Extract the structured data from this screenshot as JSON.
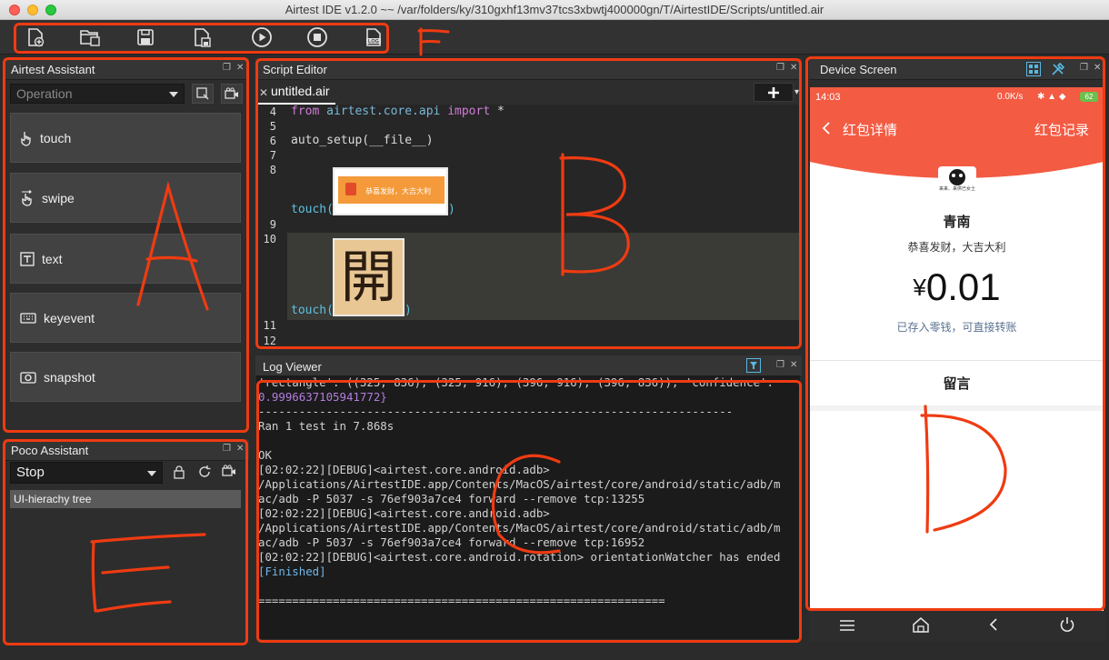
{
  "window": {
    "title": "Airtest IDE v1.2.0 ~~ /var/folders/ky/310gxhf13mv37tcs3xbwtj400000gn/T/AirtestIDE/Scripts/untitled.air"
  },
  "toolbar": {
    "buttons": [
      "new-script-icon",
      "open-folder-icon",
      "save-icon",
      "save-as-icon",
      "run-icon",
      "stop-icon",
      "log-icon"
    ],
    "log_label": "LOG"
  },
  "annotations": [
    "A",
    "B",
    "C",
    "D",
    "E",
    "F"
  ],
  "airtest_assistant": {
    "title": "Airtest Assistant",
    "select_placeholder": "Operation",
    "actions": [
      {
        "label": "touch",
        "icon": "touch-hand-icon"
      },
      {
        "label": "swipe",
        "icon": "swipe-hand-icon"
      },
      {
        "label": "text",
        "icon": "text-icon"
      },
      {
        "label": "keyevent",
        "icon": "keyboard-icon"
      },
      {
        "label": "snapshot",
        "icon": "camera-icon"
      }
    ]
  },
  "poco_assistant": {
    "title": "Poco Assistant",
    "mode": "Stop",
    "tree_item": "UI-hierachy tree"
  },
  "script_editor": {
    "title": "Script Editor",
    "tab": "untitled.air",
    "lines": [
      {
        "n": "4",
        "code": [
          "from",
          " airtest.core.api ",
          "import",
          " *"
        ]
      },
      {
        "n": "5",
        "code": []
      },
      {
        "n": "6",
        "code": [
          "auto_setup(__file__)"
        ]
      },
      {
        "n": "7",
        "code": []
      },
      {
        "n": "8",
        "code": []
      },
      {
        "n": "9",
        "code": []
      },
      {
        "n": "10",
        "code": []
      },
      {
        "n": "11",
        "code": []
      },
      {
        "n": "12",
        "code": []
      }
    ],
    "touch_call_1": "touch(",
    "touch_call_2": "touch(",
    "close_paren": ")",
    "thumb1_text": "恭喜发财，大吉大利",
    "thumb2_char": "開"
  },
  "log_viewer": {
    "title": "Log Viewer",
    "lines": [
      "'rectangle': ((325, 836), (325, 916), (396, 916), (396, 836)), 'confidence':",
      "0.9996637105941772}",
      "----------------------------------------------------------------------",
      "Ran 1 test in 7.868s",
      "",
      "OK",
      "[02:02:22][DEBUG]<airtest.core.android.adb>",
      "/Applications/AirtestIDE.app/Contents/MacOS/airtest/core/android/static/adb/m",
      "ac/adb -P 5037 -s 76ef903a7ce4 forward --remove tcp:13255",
      "[02:02:22][DEBUG]<airtest.core.android.adb>",
      "/Applications/AirtestIDE.app/Contents/MacOS/airtest/core/android/static/adb/m",
      "ac/adb -P 5037 -s 76ef903a7ce4 forward --remove tcp:16952",
      "[02:02:22][DEBUG]<airtest.core.android.rotation> orientationWatcher has ended",
      "[Finished]",
      "",
      "============================================================"
    ]
  },
  "device_screen": {
    "title": "Device Screen",
    "status_time": "14:03",
    "status_right": "0.0K/s",
    "battery": "62",
    "nav_title": "红包详情",
    "nav_right": "红包记录",
    "avatar_caption": "来来、来供已女士",
    "sender": "青南",
    "greeting": "恭喜发财，大吉大利",
    "amount_symbol": "¥",
    "amount": "0.01",
    "note": "已存入零钱，可直接转账",
    "message_label": "留言",
    "nav_buttons": [
      "menu-icon",
      "home-icon",
      "back-icon",
      "power-icon"
    ]
  },
  "colors": {
    "annotation": "#ef3b12",
    "wechat_red": "#f35b43"
  }
}
